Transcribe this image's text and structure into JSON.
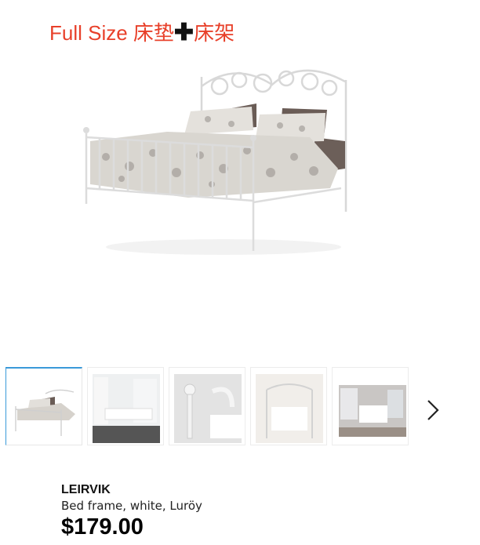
{
  "caption": {
    "prefix": "Full Size 床垫",
    "plus": "✚",
    "suffix": "床架"
  },
  "gallery": {
    "thumbnails": [
      {
        "label": "bed-frame-front",
        "active": true
      },
      {
        "label": "bedroom-curtains",
        "active": false
      },
      {
        "label": "bedpost-detail",
        "active": false
      },
      {
        "label": "headboard-room",
        "active": false
      },
      {
        "label": "bedroom-scene",
        "active": false
      }
    ],
    "next_icon": "chevron-right-icon"
  },
  "product": {
    "name": "LEIRVIK",
    "description": "Bed frame, white, Luröy",
    "price": "$179.00"
  },
  "colors": {
    "caption_red": "#e8402a",
    "active_thumb_border": "#3a9ad9"
  }
}
